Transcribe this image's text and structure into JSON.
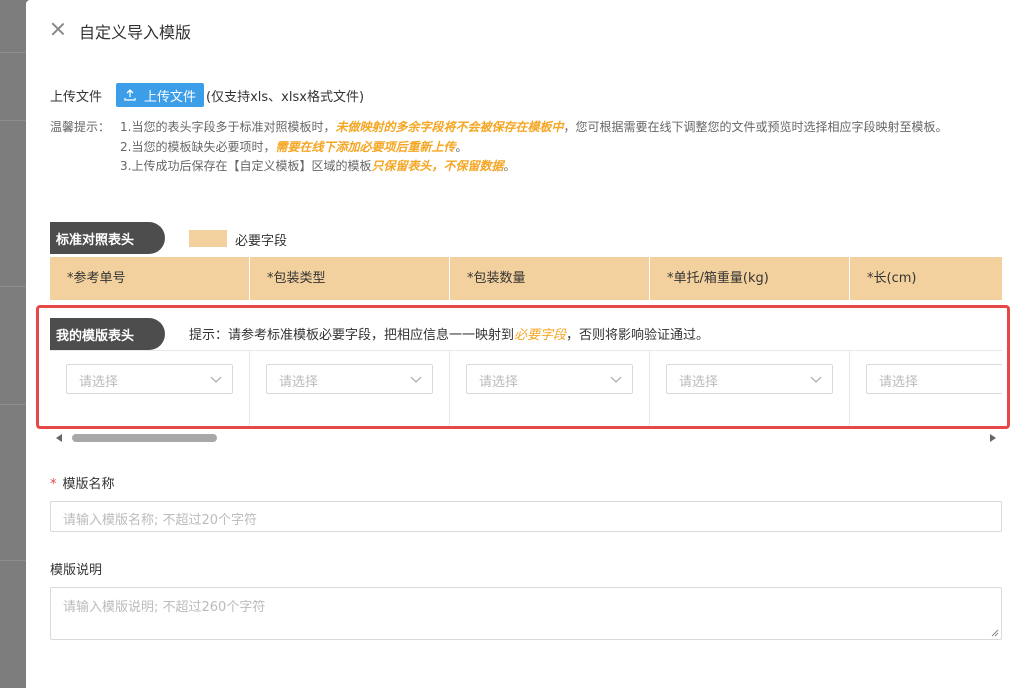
{
  "drawer": {
    "title": "自定义导入模版",
    "close_icon": "close-icon"
  },
  "upload": {
    "label": "上传文件",
    "button_label": "上传文件",
    "hint": "(仅支持xls、xlsx格式文件)"
  },
  "tips": {
    "label": "温馨提示：",
    "tip1_pre": "1.当您的表头字段多于标准对照模板时，",
    "tip1_em": "未做映射的多余字段将不会被保存在模板中",
    "tip1_post": "，您可根据需要在线下调整您的文件或预览时选择相应字段映射至模板。",
    "tip2_pre": "2.当您的模板缺失必要项时，",
    "tip2_em": "需要在线下添加必要项后重新上传",
    "tip2_post": "。",
    "tip3_pre": "3.上传成功后保存在【自定义模板】区域的模板",
    "tip3_em": "只保留表头，不保留数据",
    "tip3_post": "。"
  },
  "standard": {
    "tag": "标准对照表头",
    "legend_label": "必要字段",
    "legend_color": "#f3d19e",
    "columns": [
      "*参考单号",
      "*包装类型",
      "*包装数量",
      "*单托/箱重量(kg)",
      "*长(cm)"
    ]
  },
  "mine": {
    "tag": "我的模版表头",
    "hint_pre": "提示：请参考标准模板必要字段，把相应信息一一映射到",
    "hint_em": "必要字段",
    "hint_post": "，否则将影响验证通过。",
    "selects": [
      "请选择",
      "请选择",
      "请选择",
      "请选择",
      "请选择"
    ]
  },
  "form": {
    "name_label": "模版名称",
    "name_placeholder": "请输入模版名称; 不超过20个字符",
    "desc_label": "模版说明",
    "desc_placeholder": "请输入模版说明; 不超过260个字符"
  },
  "colors": {
    "accent": "#3c9ee8",
    "highlight": "#e64848",
    "emphasis": "#f5a623"
  }
}
